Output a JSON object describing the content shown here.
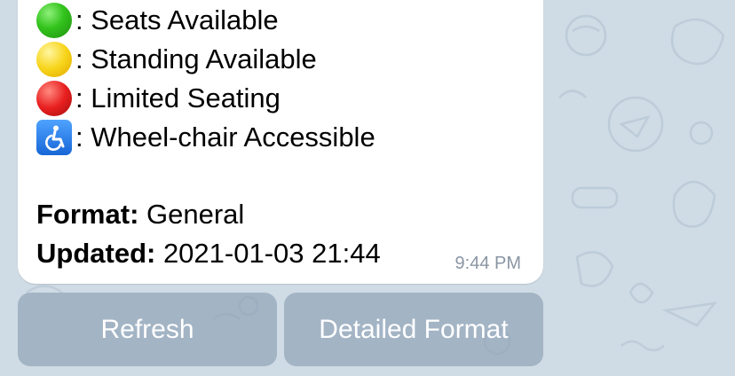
{
  "legend": [
    {
      "icon": "green-circle-icon",
      "text": ": Seats Available",
      "color": "#33c31c"
    },
    {
      "icon": "yellow-circle-icon",
      "text": ": Standing Available",
      "color": "#f7d41a"
    },
    {
      "icon": "red-circle-icon",
      "text": ": Limited Seating",
      "color": "#e81f1f"
    },
    {
      "icon": "wheelchair-icon",
      "text": ": Wheel-chair Accessible",
      "color": "#1766d6"
    }
  ],
  "format": {
    "label": "Format:",
    "value": " General"
  },
  "updated": {
    "label": "Updated:",
    "value": " 2021-01-03 21:44"
  },
  "message_time": "9:44 PM",
  "buttons": {
    "refresh": "Refresh",
    "detailed": "Detailed Format"
  }
}
